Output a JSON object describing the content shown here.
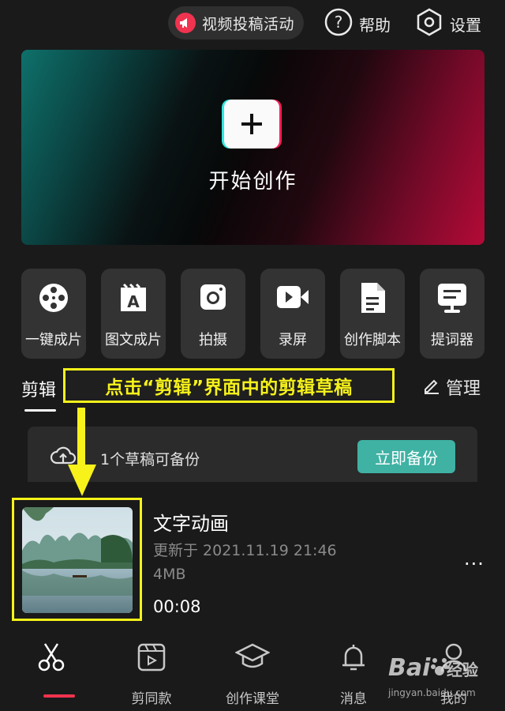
{
  "topbar": {
    "promo_label": "视频投稿活动",
    "help_label": "帮助",
    "settings_label": "设置"
  },
  "hero": {
    "start_label": "开始创作"
  },
  "tools": [
    {
      "label": "一键成片",
      "icon": "film-reel-icon"
    },
    {
      "label": "图文成片",
      "icon": "text-image-icon"
    },
    {
      "label": "拍摄",
      "icon": "camera-icon"
    },
    {
      "label": "录屏",
      "icon": "screen-record-icon"
    },
    {
      "label": "创作脚本",
      "icon": "script-doc-icon"
    },
    {
      "label": "提词器",
      "icon": "teleprompter-icon"
    }
  ],
  "tabs": {
    "edit_label": "剪辑",
    "manage_label": "管理",
    "callout": "点击“剪辑”界面中的剪辑草稿"
  },
  "backup": {
    "text": "1个草稿可备份",
    "button_label": "立即备份"
  },
  "draft": {
    "title": "文字动画",
    "updated": "更新于 2021.11.19 21:46",
    "size": "4MB",
    "duration": "00:08"
  },
  "bottom_nav": [
    {
      "label": "",
      "icon": "scissors-icon",
      "active": true
    },
    {
      "label": "剪同款",
      "icon": "template-clip-icon"
    },
    {
      "label": "创作课堂",
      "icon": "graduation-cap-icon"
    },
    {
      "label": "消息",
      "icon": "bell-icon"
    },
    {
      "label": "我的",
      "icon": "profile-icon"
    }
  ],
  "watermark": {
    "brand": "Bai",
    "brand2": "经验",
    "url": "jingyan.baidu.com"
  },
  "colors": {
    "accent_red": "#f0334f",
    "backup_teal": "#3fb2a4",
    "callout_yellow": "#f6f21a",
    "background": "#1a1a1a"
  }
}
